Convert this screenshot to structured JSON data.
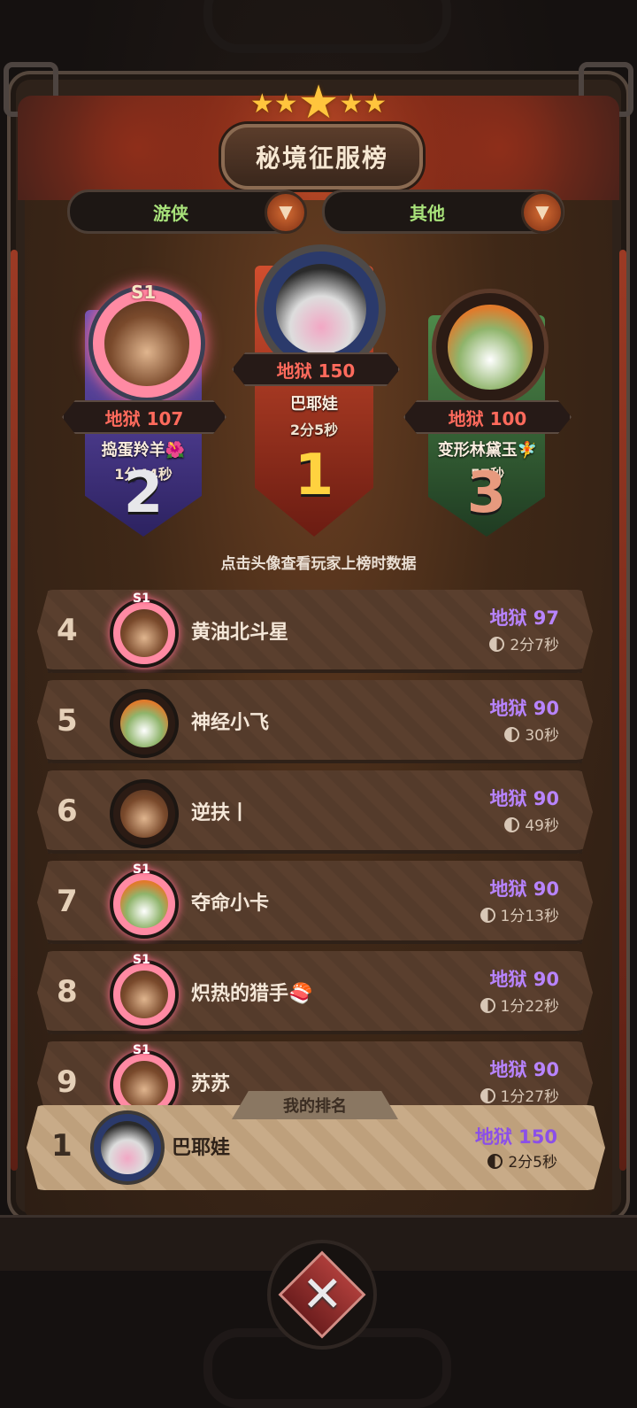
{
  "header": {
    "title": "秘境征服榜",
    "stars": "★★★★★"
  },
  "filters": {
    "class_label": "游侠",
    "other_label": "其他",
    "dropdown_glyph": "▼"
  },
  "podium": [
    {
      "rank": "2",
      "season": "S1",
      "score": "地狱 107",
      "name": "捣蛋羚羊🌺",
      "time": "1分44秒"
    },
    {
      "rank": "1",
      "season": "",
      "score": "地狱 150",
      "name": "巴耶娃",
      "time": "2分5秒"
    },
    {
      "rank": "3",
      "season": "",
      "score": "地狱 100",
      "name": "变形林黛玉🧚",
      "time": "57秒"
    }
  ],
  "hint": "点击头像查看玩家上榜时数据",
  "ranking": [
    {
      "rank": "4",
      "name": "黄油北斗星",
      "score": "地狱 97",
      "time": "2分7秒",
      "season": "S1",
      "avatar": "bear"
    },
    {
      "rank": "5",
      "name": "神经小飞",
      "score": "地狱 90",
      "time": "30秒",
      "season": "",
      "avatar": "fox"
    },
    {
      "rank": "6",
      "name": "逆扶丨",
      "score": "地狱 90",
      "time": "49秒",
      "season": "",
      "avatar": "bear"
    },
    {
      "rank": "7",
      "name": "夺命小卡",
      "score": "地狱 90",
      "time": "1分13秒",
      "season": "S1",
      "avatar": "fox"
    },
    {
      "rank": "8",
      "name": "炽热的猎手🍣",
      "score": "地狱 90",
      "time": "1分22秒",
      "season": "S1",
      "avatar": "bear"
    },
    {
      "rank": "9",
      "name": "苏苏",
      "score": "地狱 90",
      "time": "1分27秒",
      "season": "S1",
      "avatar": "bear"
    }
  ],
  "my_rank": {
    "tab_label": "我的排名",
    "rank": "1",
    "name": "巴耶娃",
    "score": "地狱 150",
    "time": "2分5秒"
  },
  "close_glyph": "✕",
  "colors": {
    "score_purple": "#b884ff",
    "score_red": "#ff6a5c",
    "filter_green": "#a8e27a",
    "gold_rank": "#ffd23f",
    "silver_rank": "#e7e7ea",
    "bronze_rank": "#e79a7e"
  }
}
